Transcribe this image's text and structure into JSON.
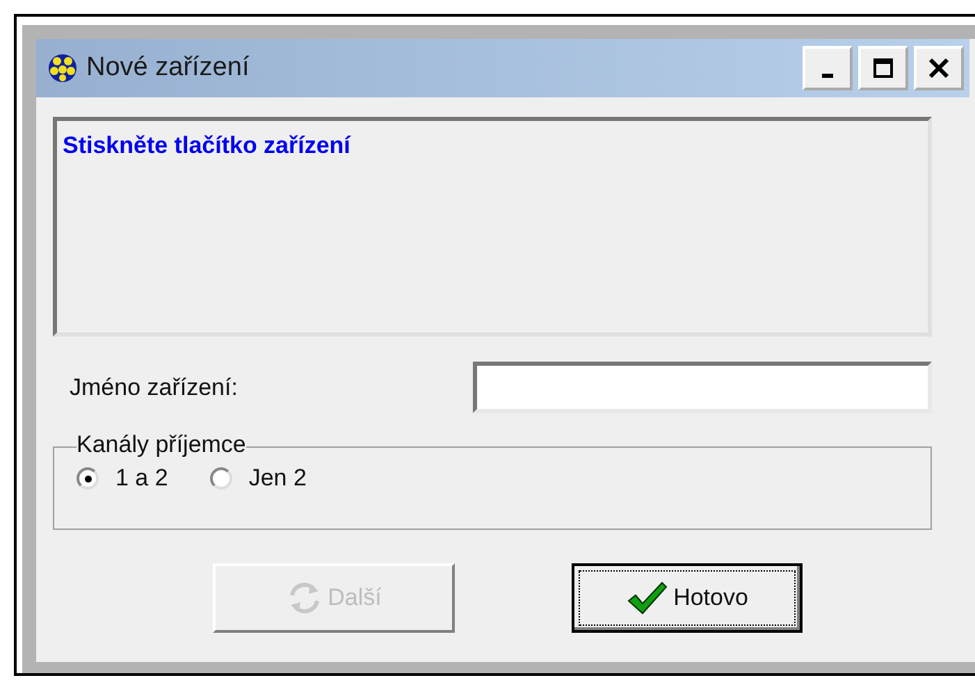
{
  "window": {
    "title": "Nové zařízení",
    "controls": [
      {
        "kind": "minimize"
      },
      {
        "kind": "maximize"
      },
      {
        "kind": "close"
      }
    ]
  },
  "message": "Stiskněte tlačítko zařízení",
  "name_field": {
    "label": "Jméno zařízení:"
  },
  "channels": {
    "title": "Kanály příjemce",
    "options": [
      {
        "label": "1 a 2",
        "selected": true
      },
      {
        "label": "Jen 2",
        "selected": false
      }
    ]
  },
  "buttons": [
    {
      "label": "Další",
      "kind": "next",
      "disabled": true,
      "focused": false
    },
    {
      "label": "Hotovo",
      "kind": "done",
      "disabled": false,
      "focused": true
    }
  ]
}
